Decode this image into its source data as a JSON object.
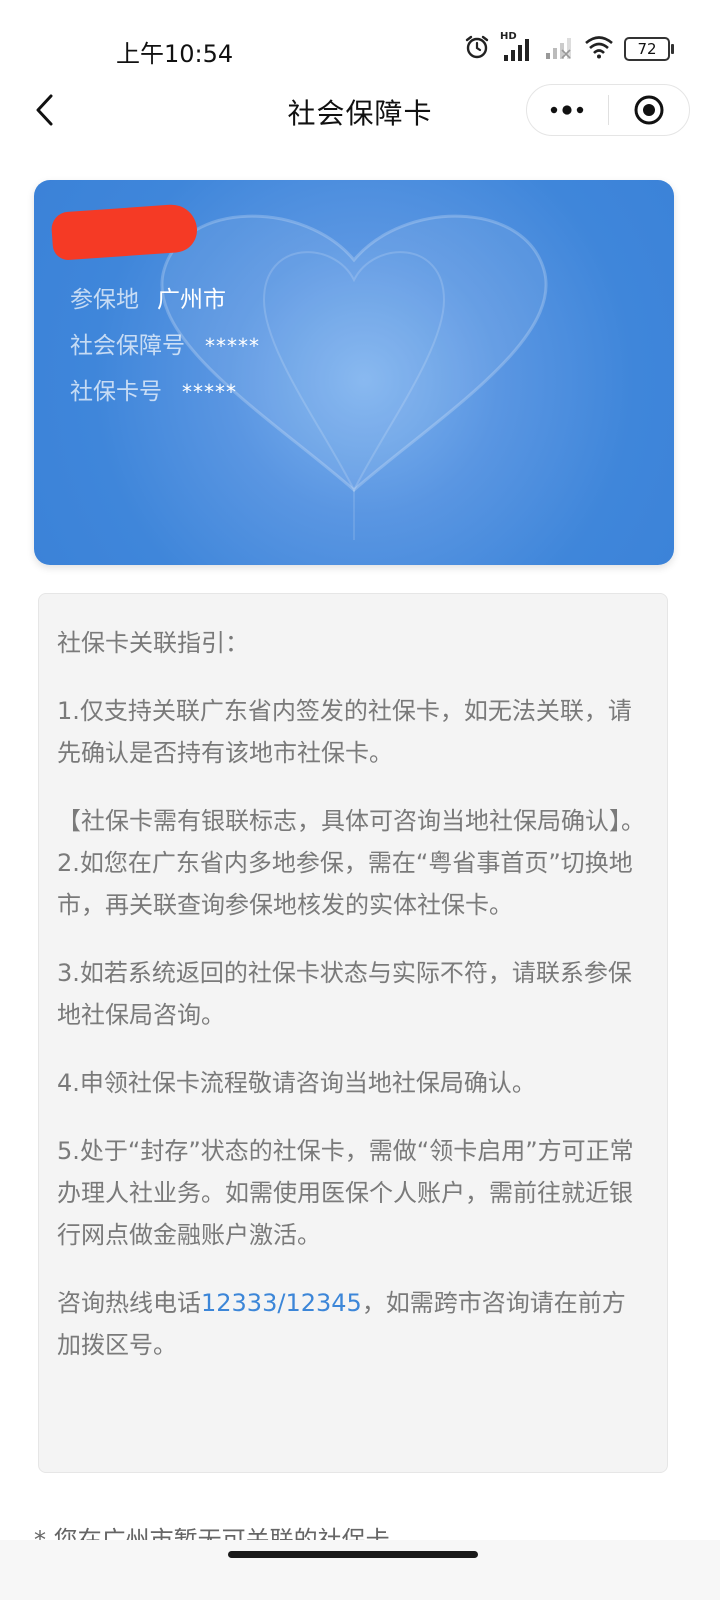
{
  "status_bar": {
    "time": "上午10:54",
    "hd_label": "HD",
    "battery": "72"
  },
  "nav": {
    "title": "社会保障卡"
  },
  "card": {
    "location_label": "参保地",
    "location_value": "广州市",
    "ss_number_label": "社会保障号",
    "ss_number_value": "*****",
    "card_number_label": "社保卡号",
    "card_number_value": "*****"
  },
  "guide": {
    "heading": "社保卡关联指引：",
    "item1": "1.仅支持关联广东省内签发的社保卡，如无法关联，请先确认是否持有该地市社保卡。",
    "note": "【社保卡需有银联标志，具体可咨询当地社保局确认】。",
    "item2": "2.如您在广东省内多地参保，需在“粤省事首页”切换地市，再关联查询参保地核发的实体社保卡。",
    "item3": "3.如若系统返回的社保卡状态与实际不符，请联系参保地社保局咨询。",
    "item4": "4.申领社保卡流程敬请咨询当地社保局确认。",
    "item5": "5.处于“封存”状态的社保卡，需做“领卡启用”方可正常办理人社业务。如需使用医保个人账户，需前往就近银行网点做金融账户激活。",
    "hotline_prefix": "咨询热线电话",
    "hotline_1": "12333",
    "hotline_sep": "/",
    "hotline_2": "12345",
    "hotline_suffix": "，如需跨市咨询请在前方加拨区号。"
  },
  "footer": {
    "partial_text": "* 您在广州市暂无可关联的社保卡"
  },
  "colors": {
    "card_blue": "#3f86da",
    "link_blue": "#3c86d8",
    "redaction_red": "#f53a25"
  }
}
